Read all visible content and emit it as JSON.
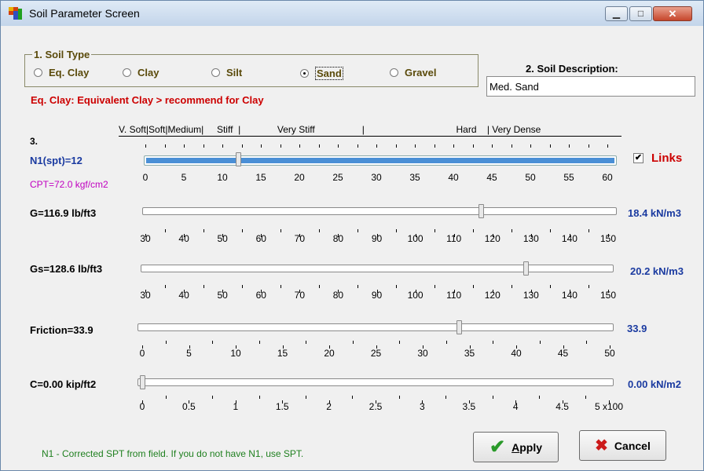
{
  "window": {
    "title": "Soil Parameter Screen"
  },
  "soil_type": {
    "legend": "1. Soil Type",
    "options": [
      {
        "label": "Eq. Clay",
        "selected": false
      },
      {
        "label": "Clay",
        "selected": false
      },
      {
        "label": "Silt",
        "selected": false
      },
      {
        "label": "Sand",
        "selected": true
      },
      {
        "label": "Gravel",
        "selected": false
      }
    ],
    "note": "Eq. Clay: Equivalent Clay > recommend for Clay"
  },
  "soil_description": {
    "label": "2. Soil Description:",
    "value": "Med. Sand"
  },
  "section3": {
    "label": "3.",
    "consistency_scale": "V. Soft|Soft|Medium|     Stiff  |              Very Stiff                  |                                   Hard    | Very Dense"
  },
  "n1": {
    "label": "N1(spt)=12",
    "value": 12,
    "min": 0,
    "max": 60,
    "ticks": [
      "0",
      "5",
      "10",
      "15",
      "20",
      "25",
      "30",
      "35",
      "40",
      "45",
      "50",
      "55",
      "60"
    ],
    "cpt": "CPT=72.0 kgf/cm2",
    "links_label": "Links",
    "links_checked": true
  },
  "g": {
    "label": "G=116.9 lb/ft3",
    "value": 116.9,
    "min": 30,
    "max": 150,
    "ticks": [
      "30",
      "40",
      "50",
      "60",
      "70",
      "80",
      "90",
      "100",
      "110",
      "120",
      "130",
      "140",
      "150"
    ],
    "metric": "18.4 kN/m3"
  },
  "gs": {
    "label": "Gs=128.6 lb/ft3",
    "value": 128.6,
    "min": 30,
    "max": 150,
    "ticks": [
      "30",
      "40",
      "50",
      "60",
      "70",
      "80",
      "90",
      "100",
      "110",
      "120",
      "130",
      "140",
      "150"
    ],
    "metric": "20.2 kN/m3"
  },
  "friction": {
    "label": "Friction=33.9",
    "value": 33.9,
    "min": 0,
    "max": 50,
    "ticks": [
      "0",
      "5",
      "10",
      "15",
      "20",
      "25",
      "30",
      "35",
      "40",
      "45",
      "50"
    ],
    "metric": "33.9"
  },
  "c": {
    "label": "C=0.00 kip/ft2",
    "value": 0,
    "min": 0,
    "max": 5,
    "ticks": [
      "0",
      "0.5",
      "1",
      "1.5",
      "2",
      "2.5",
      "3",
      "3.5",
      "4",
      "4.5",
      "5 x100"
    ],
    "metric": "0.00 kN/m2"
  },
  "footer_note": "N1 - Corrected SPT from field.  If you do not have N1, use SPT.",
  "buttons": {
    "apply": "Apply",
    "cancel": "Cancel"
  },
  "colors": {
    "title_brown": "#5a4a0a",
    "note_red": "#cc0000",
    "metric_blue": "#1a3aa0",
    "cpt_magenta": "#c000c0",
    "footer_green": "#208020"
  }
}
